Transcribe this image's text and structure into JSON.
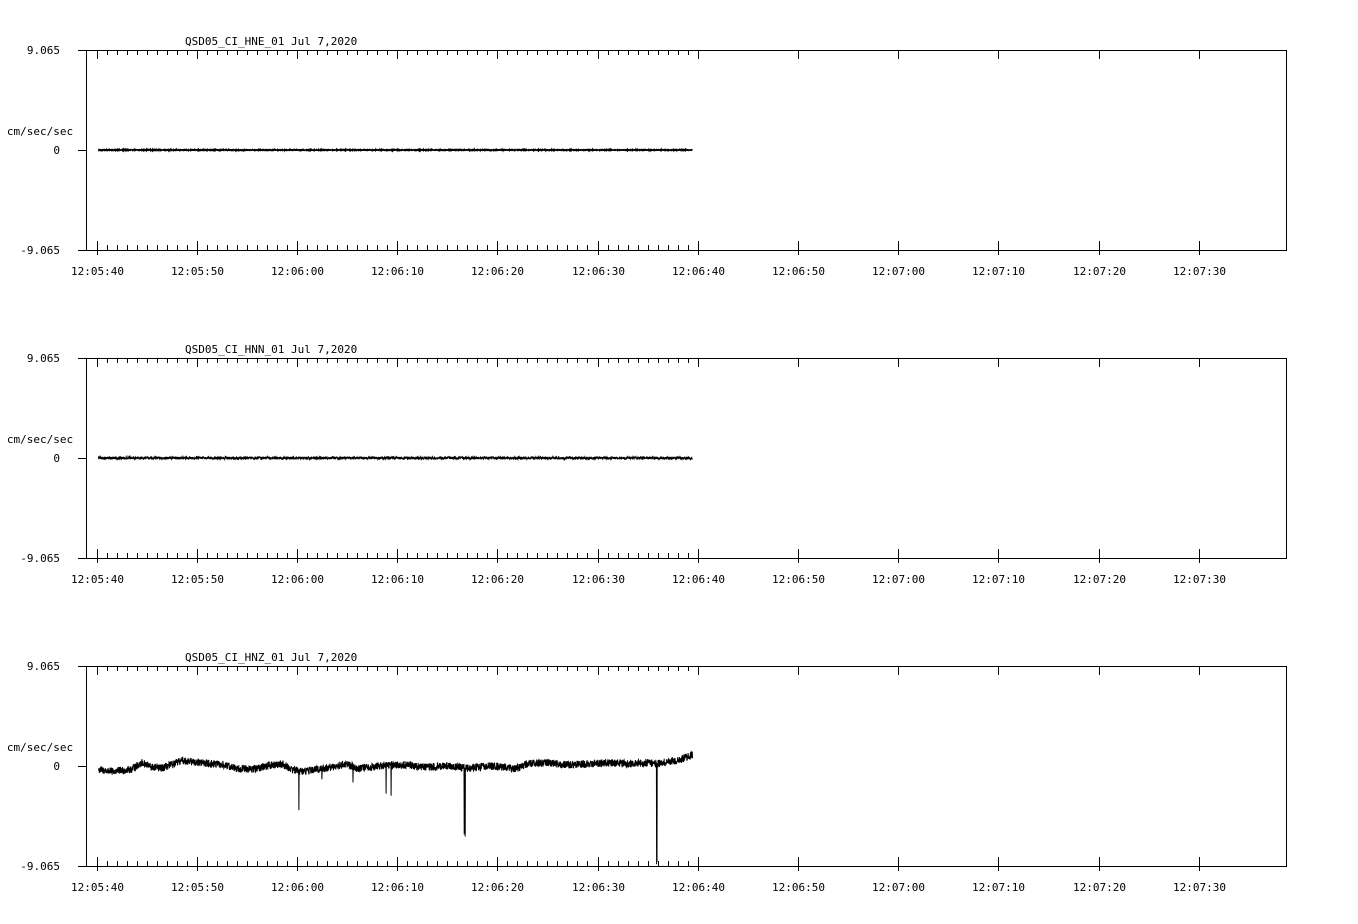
{
  "chart_data": [
    {
      "type": "line",
      "title": "QSD05_CI_HNE_01  Jul 7,2020",
      "ylabel": "cm/sec/sec",
      "ylim": [
        -9.065,
        9.065
      ],
      "y_tick_labels": [
        "9.065",
        "0",
        "-9.065"
      ],
      "x_tick_labels": [
        "12:05:40",
        "12:05:50",
        "12:06:00",
        "12:06:10",
        "12:06:20",
        "12:06:30",
        "12:06:40",
        "12:06:50",
        "12:07:00",
        "12:07:10",
        "12:07:20",
        "12:07:30"
      ],
      "xlim_seconds_after_12_05_40": [
        -0.25,
        59.5
      ],
      "grid": false,
      "trace": {
        "start_offset_s": 0.2,
        "end_offset_s": 59.5,
        "noise_amplitude": 0.03,
        "drift": [
          [
            0,
            0
          ],
          [
            60,
            0
          ]
        ],
        "spikes": []
      }
    },
    {
      "type": "line",
      "title": "QSD05_CI_HNN_01  Jul 7,2020",
      "ylabel": "cm/sec/sec",
      "ylim": [
        -9.065,
        9.065
      ],
      "y_tick_labels": [
        "9.065",
        "0",
        "-9.065"
      ],
      "x_tick_labels": [
        "12:05:40",
        "12:05:50",
        "12:06:00",
        "12:06:10",
        "12:06:20",
        "12:06:30",
        "12:06:40",
        "12:06:50",
        "12:07:00",
        "12:07:10",
        "12:07:20",
        "12:07:30"
      ],
      "xlim_seconds_after_12_05_40": [
        -0.25,
        59.5
      ],
      "grid": false,
      "trace": {
        "start_offset_s": 0.2,
        "end_offset_s": 59.5,
        "noise_amplitude": 0.12,
        "drift": [
          [
            0,
            0
          ],
          [
            60,
            0
          ]
        ],
        "spikes": []
      }
    },
    {
      "type": "line",
      "title": "QSD05_CI_HNZ_01  Jul 7,2020",
      "ylabel": "cm/sec/sec",
      "ylim": [
        -9.065,
        9.065
      ],
      "y_tick_labels": [
        "9.065",
        "0",
        "-9.065"
      ],
      "x_tick_labels": [
        "12:05:40",
        "12:05:50",
        "12:06:00",
        "12:06:10",
        "12:06:20",
        "12:06:30",
        "12:06:40",
        "12:06:50",
        "12:07:00",
        "12:07:10",
        "12:07:20",
        "12:07:30"
      ],
      "xlim_seconds_after_12_05_40": [
        -0.25,
        59.5
      ],
      "grid": false,
      "trace": {
        "start_offset_s": 0.2,
        "end_offset_s": 59.5,
        "noise_amplitude": 0.35,
        "drift": [
          [
            0,
            -0.3
          ],
          [
            1.5,
            -0.5
          ],
          [
            2.5,
            -0.4
          ],
          [
            3.5,
            -0.3
          ],
          [
            4.5,
            0.3
          ],
          [
            5.5,
            -0.1
          ],
          [
            6.5,
            -0.2
          ],
          [
            7.5,
            0.1
          ],
          [
            8.5,
            0.5
          ],
          [
            10.5,
            0.3
          ],
          [
            12.5,
            0.1
          ],
          [
            14,
            -0.2
          ],
          [
            15.5,
            -0.3
          ],
          [
            17,
            0
          ],
          [
            18.5,
            0.2
          ],
          [
            19.5,
            -0.3
          ],
          [
            20.5,
            -0.5
          ],
          [
            22,
            -0.3
          ],
          [
            23.5,
            -0.1
          ],
          [
            25,
            0.2
          ],
          [
            26,
            -0.2
          ],
          [
            27.5,
            -0.1
          ],
          [
            29,
            0.1
          ],
          [
            31,
            0.1
          ],
          [
            33,
            -0.1
          ],
          [
            35,
            0
          ],
          [
            37,
            -0.2
          ],
          [
            39,
            0
          ],
          [
            41,
            -0.1
          ],
          [
            41.5,
            -0.3
          ],
          [
            42,
            -0.2
          ],
          [
            43,
            0.2
          ],
          [
            45,
            0.3
          ],
          [
            47,
            0.1
          ],
          [
            49,
            0.2
          ],
          [
            51,
            0.3
          ],
          [
            53,
            0.2
          ],
          [
            55,
            0.3
          ],
          [
            56,
            0.2
          ],
          [
            57,
            0.4
          ],
          [
            58,
            0.5
          ],
          [
            59.5,
            1.0
          ]
        ],
        "spikes": [
          {
            "t": 20.2,
            "value": -4.0
          },
          {
            "t": 22.5,
            "value": -1.2
          },
          {
            "t": 25.6,
            "value": -1.5
          },
          {
            "t": 28.9,
            "value": -2.5
          },
          {
            "t": 29.4,
            "value": -2.7
          },
          {
            "t": 36.7,
            "value": -6.2
          },
          {
            "t": 36.8,
            "value": -6.4
          },
          {
            "t": 55.9,
            "value": -8.9
          },
          {
            "t": 55.95,
            "value": -8.7
          }
        ]
      }
    }
  ]
}
